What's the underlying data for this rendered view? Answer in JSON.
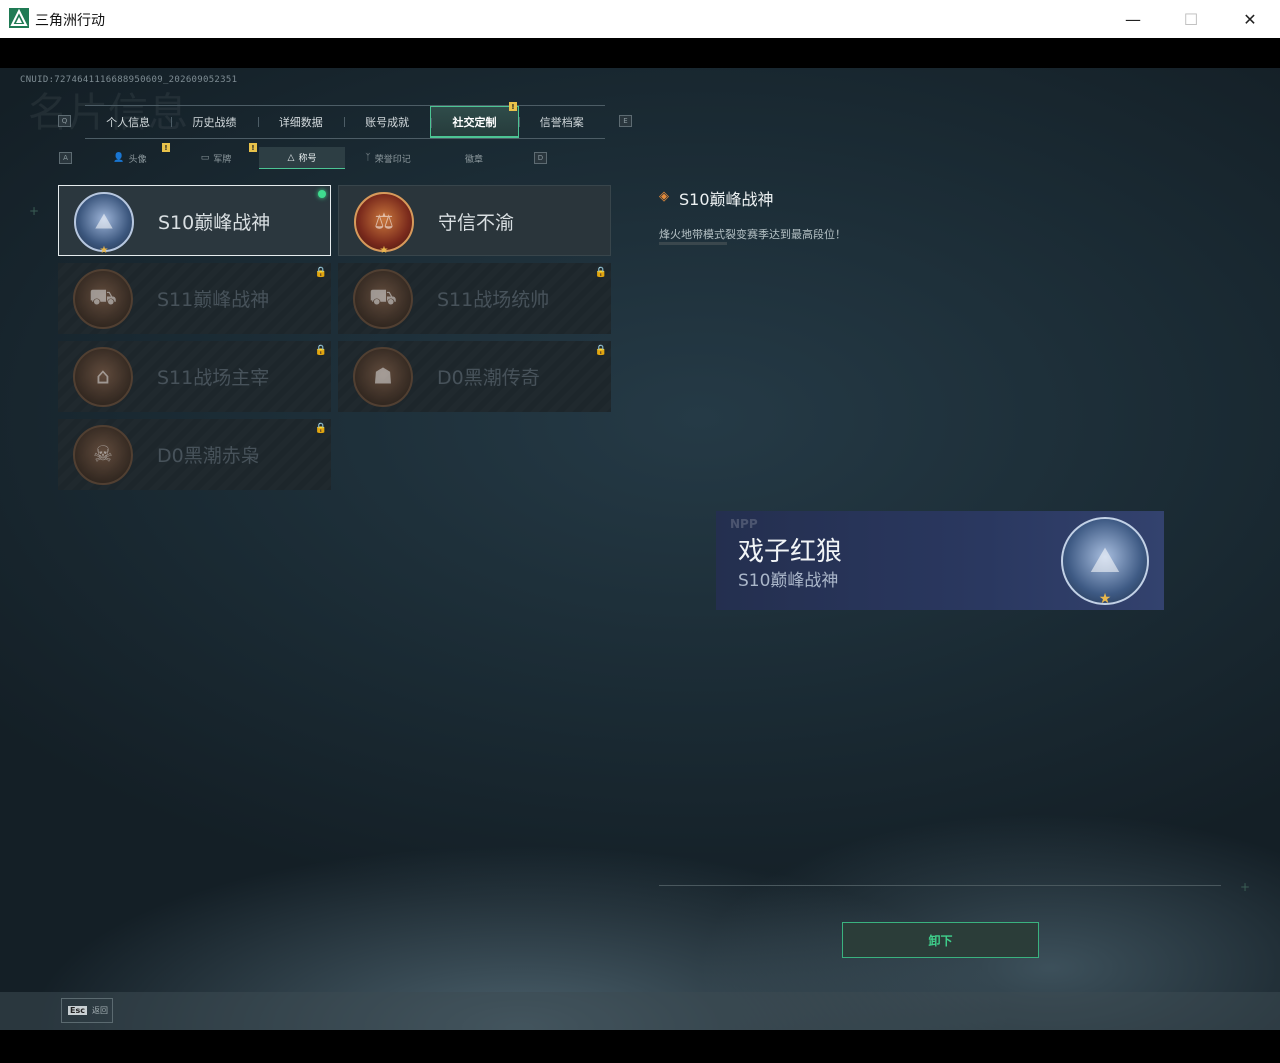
{
  "window": {
    "title": "三角洲行动",
    "minimize": "—",
    "maximize": "☐",
    "close": "✕"
  },
  "header": {
    "uid": "CNUID:7274641116688950609_20260905235​1",
    "ghost_title": "名片信息"
  },
  "tabs": [
    {
      "label": "个人信息"
    },
    {
      "label": "历史战绩"
    },
    {
      "label": "详细数据"
    },
    {
      "label": "账号成就"
    },
    {
      "label": "社交定制"
    },
    {
      "label": "信誉档案"
    }
  ],
  "tab_keys": {
    "left": "Q",
    "right": "E"
  },
  "subtabs": [
    {
      "label": "头像",
      "icon": "👤"
    },
    {
      "label": "军牌",
      "icon": "▭"
    },
    {
      "label": "称号",
      "icon": "△"
    },
    {
      "label": "荣誉印记",
      "icon": "ᛉ"
    },
    {
      "label": "徽章",
      "icon": ""
    }
  ],
  "subtab_keys": {
    "left": "A",
    "right": "D"
  },
  "titles": [
    {
      "label": "S10巅峰战神",
      "medal": "blue",
      "state": "equipped"
    },
    {
      "label": "守信不渝",
      "medal": "red",
      "state": "owned"
    },
    {
      "label": "S11巅峰战神",
      "medal": "bronze",
      "state": "locked"
    },
    {
      "label": "S11战场统帅",
      "medal": "bronze",
      "state": "locked"
    },
    {
      "label": "S11战场主宰",
      "medal": "bronze",
      "state": "locked"
    },
    {
      "label": "D0黑潮传奇",
      "medal": "bronze",
      "state": "locked"
    },
    {
      "label": "D0黑潮赤枭",
      "medal": "bronze",
      "state": "locked"
    }
  ],
  "detail": {
    "title": "S10巅峰战神",
    "description": "烽火地带模式裂变赛季达到最高段位！"
  },
  "preview": {
    "ghost": "NPP",
    "player_name": "戏子红狼",
    "title": "S10巅峰战神"
  },
  "actions": {
    "unequip": "卸下"
  },
  "footer": {
    "esc_key": "Esc",
    "esc_label": "返回"
  },
  "colors": {
    "accent": "#4cc494",
    "badge": "#e8c24a",
    "equipped_dot": "#3fdc8f"
  }
}
